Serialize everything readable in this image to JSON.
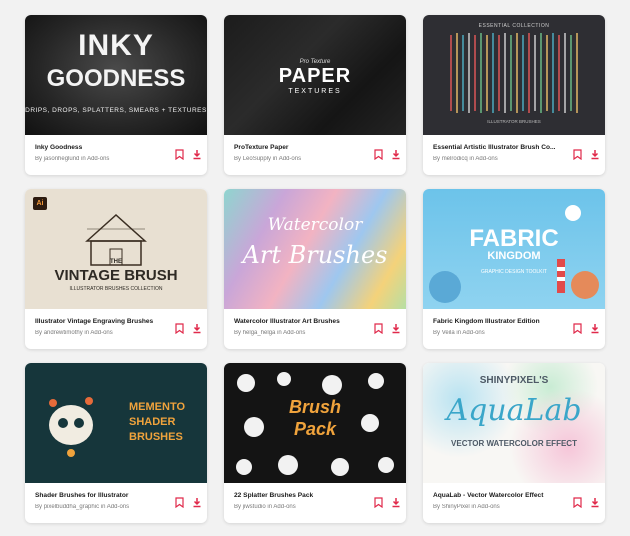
{
  "accent_color": "#e0294a",
  "cards": [
    {
      "title": "Inky Goodness",
      "by": "By",
      "author": "jasonheglund",
      "in": "in",
      "category": "Add-ons",
      "thumb": {
        "line1": "INKY",
        "line2": "GOODNESS",
        "line3": "DRIPS, DROPS, SPLATTERS, SMEARS + TEXTURES"
      }
    },
    {
      "title": "ProTexture Paper",
      "by": "By",
      "author": "LeoSupply",
      "in": "in",
      "category": "Add-ons",
      "thumb": {
        "line1": "Pro Texture",
        "line2": "PAPER",
        "line3": "TEXTURES"
      }
    },
    {
      "title": "Essential Artistic Illustrator Brush Co...",
      "by": "By",
      "author": "melrodicq",
      "in": "in",
      "category": "Add-ons",
      "thumb": {
        "line1": "ESSENTIAL COLLECTION",
        "line2": "",
        "line3": "ILLUSTRATOR BRUSHES"
      }
    },
    {
      "title": "Illustrator Vintage Engraving Brushes",
      "by": "By",
      "author": "andrewtimothy",
      "in": "in",
      "category": "Add-ons",
      "thumb": {
        "badge": "Ai",
        "line1": "THE",
        "line2": "VINTAGE BRUSH",
        "line3": "ILLUSTRATOR BRUSHES COLLECTION"
      }
    },
    {
      "title": "Watercolor Illustrator Art Brushes",
      "by": "By",
      "author": "helga_helga",
      "in": "in",
      "category": "Add-ons",
      "thumb": {
        "line1": "Watercolor",
        "line2": "Art Brushes",
        "line3": ""
      }
    },
    {
      "title": "Fabric Kingdom Illustrator Edition",
      "by": "By",
      "author": "Veila",
      "in": "in",
      "category": "Add-ons",
      "thumb": {
        "line1": "FABRIC",
        "line2": "KINGDOM",
        "line3": "GRAPHIC DESIGN TOOLKIT"
      }
    },
    {
      "title": "Shader Brushes for Illustrator",
      "by": "By",
      "author": "pixelbuddha_graphic",
      "in": "in",
      "category": "Add-ons",
      "thumb": {
        "line1": "MEMENTO",
        "line2": "SHADER",
        "line3": "BRUSHES"
      }
    },
    {
      "title": "22 Splatter Brushes Pack",
      "by": "By",
      "author": "jiwstudio",
      "in": "in",
      "category": "Add-ons",
      "thumb": {
        "line1": "Brush",
        "line2": "Pack",
        "line3": ""
      }
    },
    {
      "title": "AquaLab - Vector Watercolor Effect",
      "by": "By",
      "author": "ShinyPixel",
      "in": "in",
      "category": "Add-ons",
      "thumb": {
        "line1": "SHINYPIXEL'S",
        "line2": "AquaLab",
        "line3": "VECTOR WATERCOLOR EFFECT"
      }
    }
  ]
}
